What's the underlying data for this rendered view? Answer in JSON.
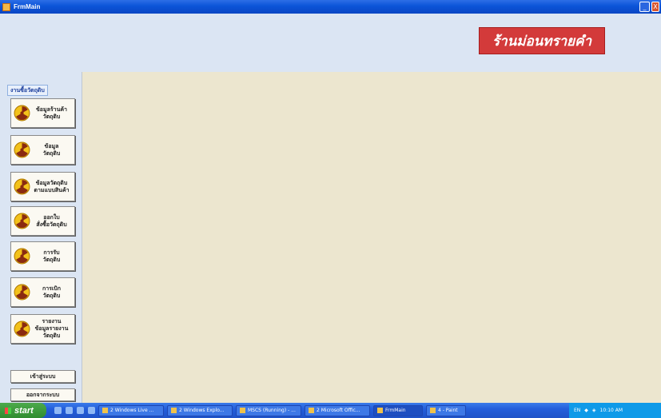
{
  "window": {
    "title": "FrmMain",
    "min_label": "_",
    "close_label": "X"
  },
  "brand": {
    "text": "ร้านม่อนทรายคำ"
  },
  "sidebar": {
    "section_label": "งานซื้อวัตถุดิบ",
    "items": [
      {
        "label": "ข้อมูลร้านค้า\nวัตถุดิบ"
      },
      {
        "label": "ข้อมูล\nวัตถุดิบ"
      },
      {
        "label": "ข้อมูลวัตถุดิบ\nตามแบบสินค้า"
      },
      {
        "label": "ออกใบ\nสั่งซื้อวัตถุดิบ"
      },
      {
        "label": "การรับ\nวัตถุดิบ"
      },
      {
        "label": "การเบิก\nวัตถุดิบ"
      },
      {
        "label": "รายงาน\nข้อมูลรายงานวัตถุดิบ"
      }
    ],
    "login_label": "เข้าสู่ระบบ",
    "logout_label": "ออกจากระบบ"
  },
  "taskbar": {
    "start_label": "start",
    "tasks": [
      {
        "label": "2 Windows Live ..."
      },
      {
        "label": "2 Windows Explo..."
      },
      {
        "label": "MSCS (Running) - ..."
      },
      {
        "label": "2 Microsoft Offic..."
      },
      {
        "label": "FrmMain"
      },
      {
        "label": "4 - Paint"
      }
    ],
    "tray_lang": "EN",
    "tray_time": "10:10 AM"
  },
  "colors": {
    "brand_bg": "#d33a3a",
    "content_bg": "#ece6cf",
    "panel_bg": "#dbe5f3",
    "titlebar": "#0b54d8"
  }
}
